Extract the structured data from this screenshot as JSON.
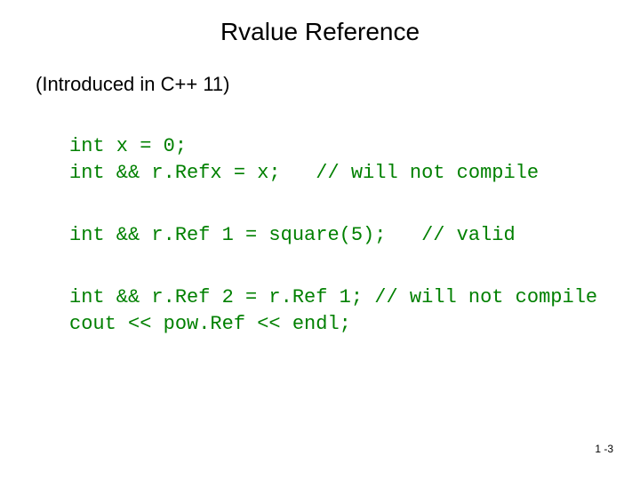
{
  "title": "Rvalue Reference",
  "subtitle": "(Introduced in C++ 11)",
  "code": {
    "block1_line1": "int x = 0;",
    "block1_line2": "int && r.Refx = x;   // will not compile",
    "block2_line1": "int && r.Ref 1 = square(5);   // valid",
    "block3_line1": "int && r.Ref 2 = r.Ref 1; // will not compile",
    "block3_line2": "cout << pow.Ref << endl;"
  },
  "page_number": "1 -3"
}
